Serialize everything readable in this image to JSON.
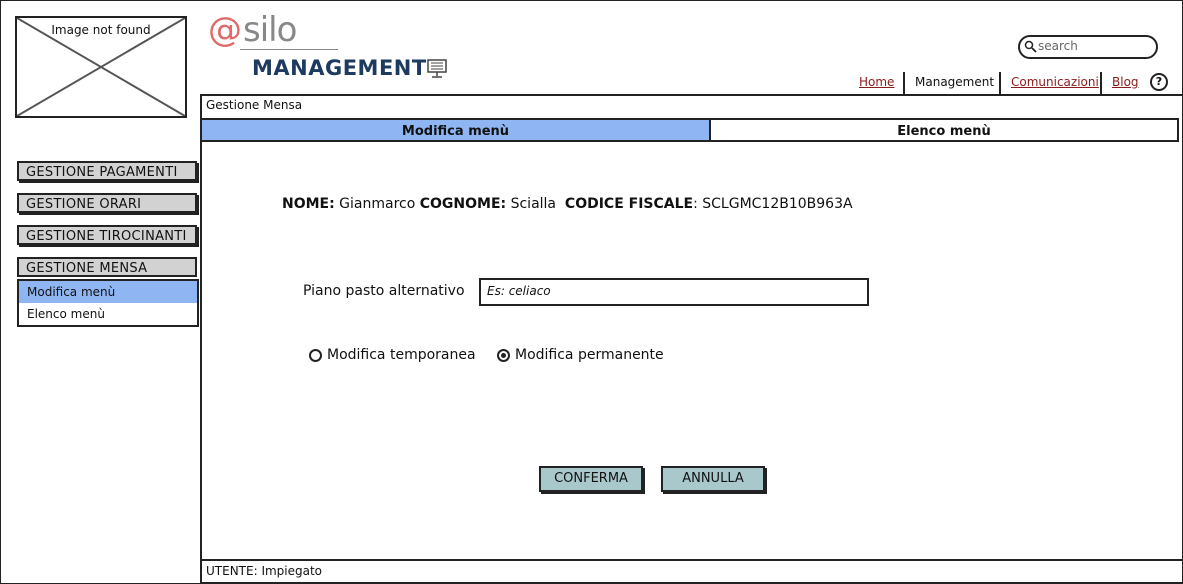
{
  "logo_placeholder": {
    "caption": "Image not found"
  },
  "brand": {
    "at": "@",
    "name": "silo",
    "subtitle": "MANAGEMENT",
    "icon": "monitor-icon"
  },
  "search": {
    "placeholder": "search",
    "icon": "search-icon"
  },
  "nav": {
    "items": [
      {
        "label": "Home"
      },
      {
        "label": "Management"
      },
      {
        "label": "Comunicazioni"
      },
      {
        "label": "Blog"
      }
    ],
    "help": "?"
  },
  "section": {
    "title": "Gestione Mensa"
  },
  "tabs": [
    {
      "label": "Modifica menù",
      "active": true
    },
    {
      "label": "Elenco menù",
      "active": false
    }
  ],
  "person": {
    "nome_label": "NOME:",
    "nome": "Gianmarco",
    "cognome_label": "COGNOME:",
    "cognome": "Scialla",
    "cf_label": "CODICE FISCALE",
    "cf_sep": ":",
    "cf": "SCLGMC12B10B963A"
  },
  "form": {
    "piano_label": "Piano pasto alternativo",
    "piano_placeholder": "Es: celiaco",
    "radio_options": [
      {
        "label": "Modifica temporanea",
        "selected": false
      },
      {
        "label": "Modifica permanente",
        "selected": true
      }
    ],
    "confirm": "CONFERMA",
    "cancel": "ANNULLA"
  },
  "sidebar": {
    "items": [
      {
        "label": "GESTIONE PAGAMENTI"
      },
      {
        "label": "GESTIONE ORARI"
      },
      {
        "label": "GESTIONE TIROCINANTI"
      },
      {
        "label": "GESTIONE MENSA"
      }
    ],
    "submenu": [
      {
        "label": "Modifica menù",
        "active": true
      },
      {
        "label": "Elenco menù",
        "active": false
      }
    ]
  },
  "footer": {
    "user": "UTENTE: Impiegato"
  },
  "colors": {
    "tab_active": "#8fb6f2",
    "button": "#a8c8cc",
    "sidebar_button": "#d2d2d2",
    "link": "#8b1a1a",
    "brand_at": "#e06a6a",
    "brand_title": "#1e3a5f"
  }
}
